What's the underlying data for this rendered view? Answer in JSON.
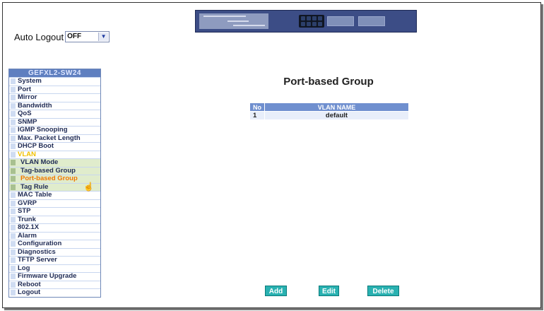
{
  "auto_logout": {
    "label": "Auto Logout",
    "value": "OFF"
  },
  "sidebar": {
    "title": "GEFXL2-SW24",
    "items": [
      {
        "label": "System",
        "kind": "item"
      },
      {
        "label": "Port",
        "kind": "item"
      },
      {
        "label": "Mirror",
        "kind": "item"
      },
      {
        "label": "Bandwidth",
        "kind": "item"
      },
      {
        "label": "QoS",
        "kind": "item"
      },
      {
        "label": "SNMP",
        "kind": "item"
      },
      {
        "label": "IGMP Snooping",
        "kind": "item"
      },
      {
        "label": "Max. Packet Length",
        "kind": "item"
      },
      {
        "label": "DHCP Boot",
        "kind": "item"
      },
      {
        "label": "VLAN",
        "kind": "vlan"
      },
      {
        "label": "VLAN Mode",
        "kind": "sub"
      },
      {
        "label": "Tag-based Group",
        "kind": "sub"
      },
      {
        "label": "Port-based Group",
        "kind": "sub-active"
      },
      {
        "label": "Tag Rule",
        "kind": "sub"
      },
      {
        "label": "MAC Table",
        "kind": "item"
      },
      {
        "label": "GVRP",
        "kind": "item"
      },
      {
        "label": "STP",
        "kind": "item"
      },
      {
        "label": "Trunk",
        "kind": "item"
      },
      {
        "label": "802.1X",
        "kind": "item"
      },
      {
        "label": "Alarm",
        "kind": "item"
      },
      {
        "label": "Configuration",
        "kind": "item"
      },
      {
        "label": "Diagnostics",
        "kind": "item"
      },
      {
        "label": "TFTP Server",
        "kind": "item"
      },
      {
        "label": "Log",
        "kind": "item"
      },
      {
        "label": "Firmware Upgrade",
        "kind": "item"
      },
      {
        "label": "Reboot",
        "kind": "item"
      },
      {
        "label": "Logout",
        "kind": "item"
      }
    ]
  },
  "main": {
    "title": "Port-based Group",
    "table": {
      "headers": [
        "No",
        "VLAN NAME"
      ],
      "rows": [
        [
          "1",
          "default"
        ]
      ]
    },
    "buttons": {
      "add": "Add",
      "edit": "Edit",
      "delete": "Delete"
    }
  },
  "colors": {
    "sidebar_header": "#5f7fc0",
    "vlan_label": "#f0c000",
    "active_item": "#f07800",
    "button": "#29b1b1",
    "table_header": "#6f8fcf"
  }
}
